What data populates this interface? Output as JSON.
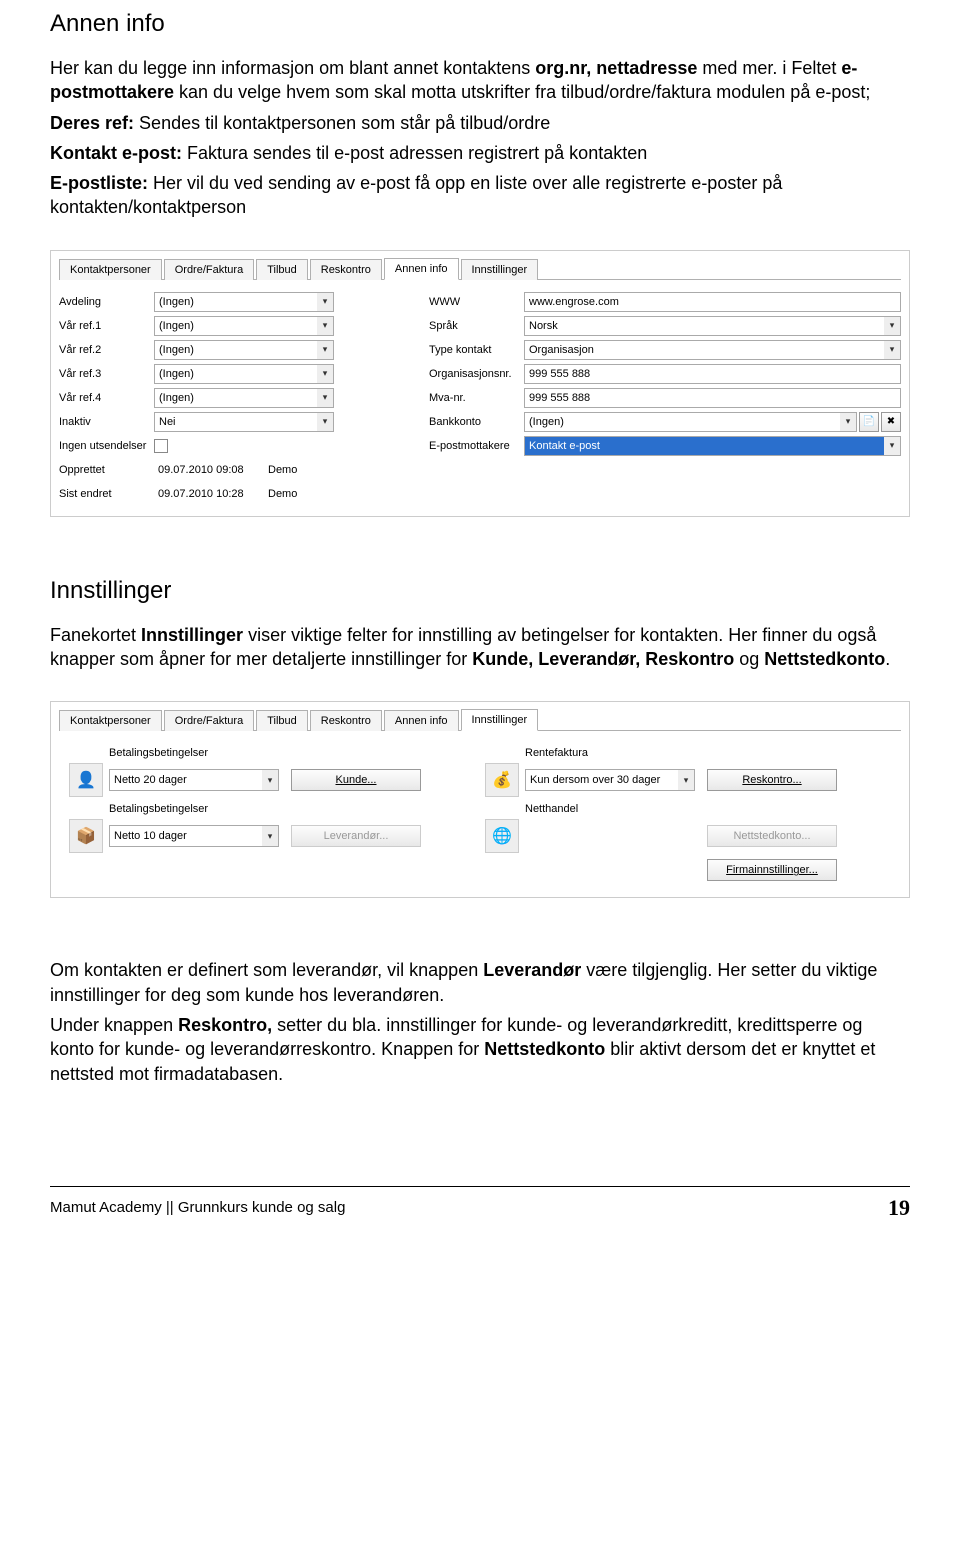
{
  "section1": {
    "heading": "Annen info",
    "p1_a": "Her kan du legge inn informasjon om blant annet kontaktens ",
    "p1_b": "org.nr, nettadresse",
    "p1_c": " med mer. i Feltet ",
    "p1_d": "e-postmottakere",
    "p1_e": " kan du velge hvem som skal motta utskrifter fra tilbud/ordre/faktura modulen på e-post;",
    "p2_a": "Deres ref:",
    "p2_b": " Sendes til kontaktpersonen som står på tilbud/ordre",
    "p3_a": "Kontakt e-post:",
    "p3_b": " Faktura sendes til e-post adressen registrert på kontakten",
    "p4_a": "E-postliste:",
    "p4_b": " Her vil du ved sending av e-post få opp en liste over alle registrerte e-poster på kontakten/kontaktperson"
  },
  "shot1": {
    "tabs": [
      "Kontaktpersoner",
      "Ordre/Faktura",
      "Tilbud",
      "Reskontro",
      "Annen info",
      "Innstillinger"
    ],
    "active": 4,
    "left_labels": [
      "Avdeling",
      "Vår ref.1",
      "Vår ref.2",
      "Vår ref.3",
      "Vår ref.4",
      "Inaktiv",
      "Ingen utsendelser",
      "Opprettet",
      "Sist endret"
    ],
    "left_values": {
      "avdeling": "(Ingen)",
      "ref1": "(Ingen)",
      "ref2": "(Ingen)",
      "ref3": "(Ingen)",
      "ref4": "(Ingen)",
      "inaktiv": "Nei",
      "opprettet_dt": "09.07.2010 09:08",
      "opprettet_by": "Demo",
      "sist_dt": "09.07.2010 10:28",
      "sist_by": "Demo"
    },
    "right_labels": [
      "WWW",
      "Språk",
      "Type kontakt",
      "Organisasjonsnr.",
      "Mva-nr.",
      "Bankkonto",
      "E-postmottakere"
    ],
    "right_values": {
      "www": "www.engrose.com",
      "sprak": "Norsk",
      "type": "Organisasjon",
      "orgnr": "999 555 888",
      "mva": "999 555 888",
      "bank": "(Ingen)",
      "epost": "Kontakt e-post"
    }
  },
  "section2": {
    "heading": "Innstillinger",
    "p1_a": "Fanekortet ",
    "p1_b": "Innstillinger",
    "p1_c": " viser viktige felter for innstilling av betingelser for kontakten. Her finner du også knapper som åpner for mer detaljerte innstillinger for ",
    "p1_d": "Kunde, Leverandør, Reskontro",
    "p1_e": " og ",
    "p1_f": "Nettstedkonto",
    "p1_g": "."
  },
  "shot2": {
    "tabs": [
      "Kontaktpersoner",
      "Ordre/Faktura",
      "Tilbud",
      "Reskontro",
      "Annen info",
      "Innstillinger"
    ],
    "active": 5,
    "left_title": "Betalingsbetingelser",
    "left_combo1": "Netto 20 dager",
    "left_btn1": "Kunde...",
    "left_title2": "Betalingsbetingelser",
    "left_combo2": "Netto 10 dager",
    "left_btn2": "Leverandør...",
    "right_title": "Rentefaktura",
    "right_combo1": "Kun dersom over 30 dager",
    "right_btn1": "Reskontro...",
    "right_title2": "Netthandel",
    "right_btn2": "Nettstedkonto...",
    "right_btn3": "Firmainnstillinger..."
  },
  "section3": {
    "p1_a": "Om kontakten er definert som leverandør, vil knappen ",
    "p1_b": "Leverandør",
    "p1_c": " være tilgjenglig. Her setter du viktige innstillinger for deg som kunde hos leverandøren.",
    "p2_a": "Under knappen ",
    "p2_b": "Reskontro,",
    "p2_c": " setter du bla. innstillinger for kunde- og leverandørkreditt, kredittsperre og konto for kunde- og leverandørreskontro. Knappen for ",
    "p2_d": "Nettstedkonto",
    "p2_e": " blir aktivt dersom det er knyttet et nettsted mot firmadatabasen."
  },
  "footer": {
    "left": "Mamut Academy || Grunnkurs kunde og salg",
    "page": "19"
  }
}
